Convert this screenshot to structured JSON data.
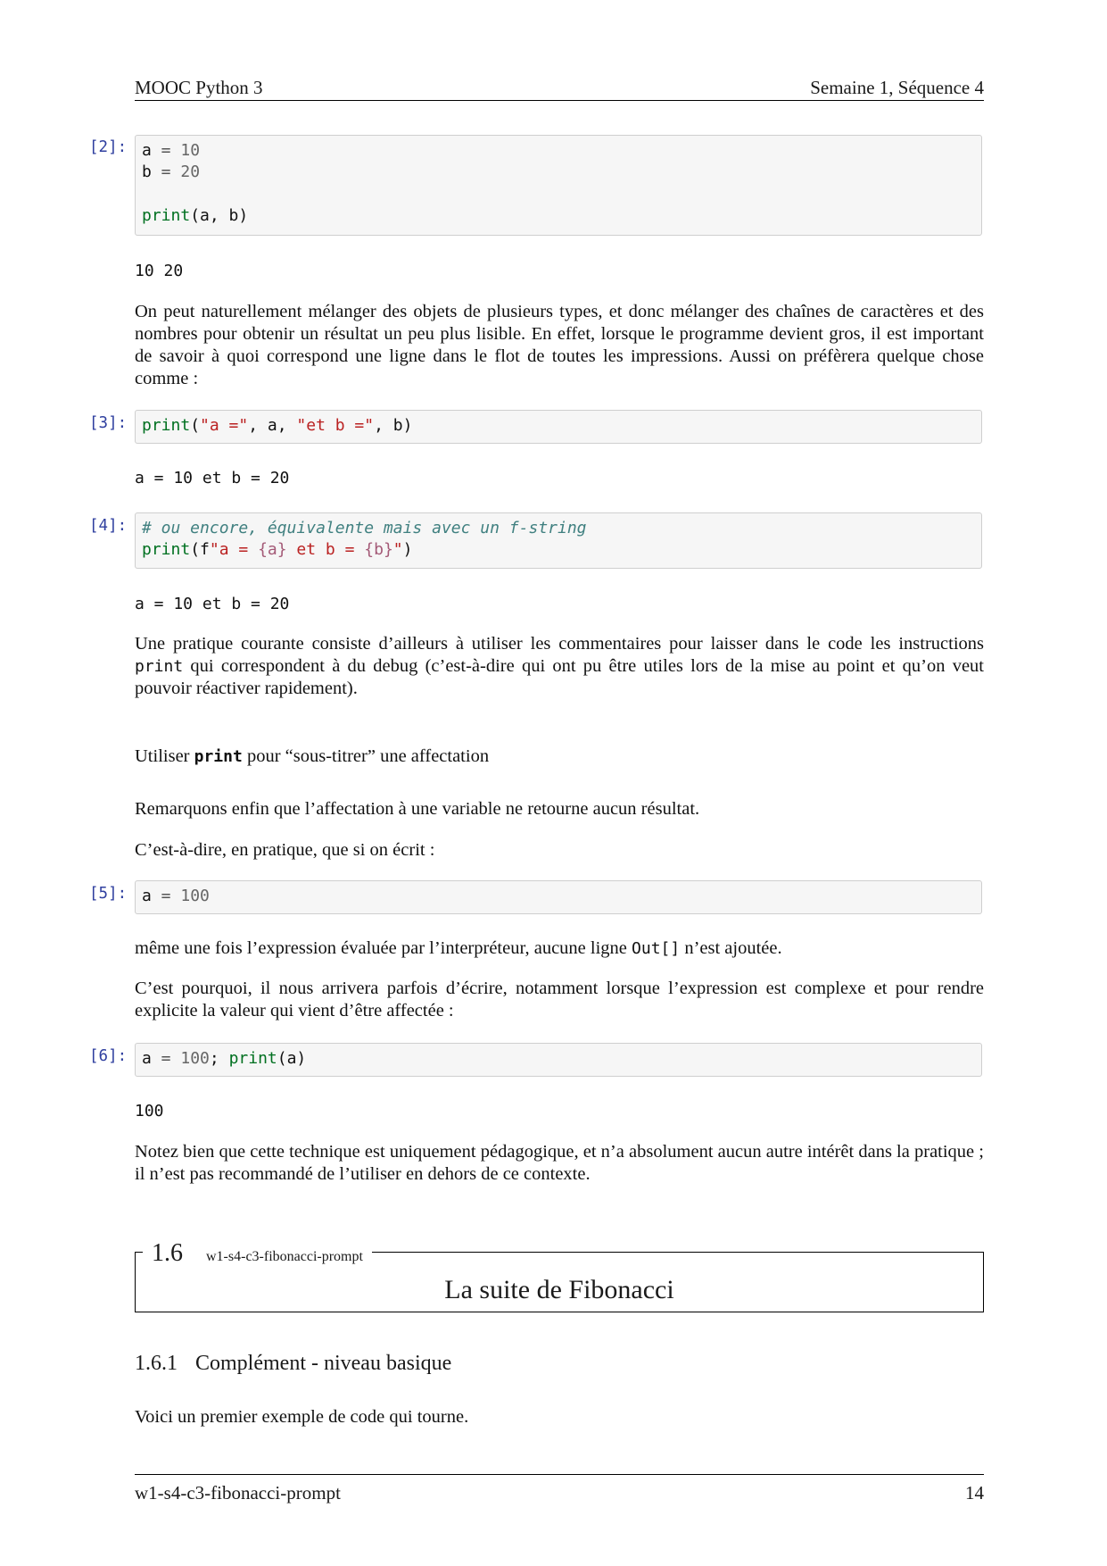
{
  "header": {
    "left": "MOOC Python 3",
    "right": "Semaine 1, Séquence 4"
  },
  "cells": [
    {
      "prompt": "[2]:",
      "lines": [
        [
          [
            "",
            "a"
          ],
          [
            "op",
            " = "
          ],
          [
            "num",
            "10"
          ]
        ],
        [
          [
            "",
            "b"
          ],
          [
            "op",
            " = "
          ],
          [
            "num",
            "20"
          ]
        ],
        [],
        [
          [
            "fn",
            "print"
          ],
          [
            "",
            "(a, b)"
          ]
        ]
      ],
      "output": "10 20"
    },
    {
      "prompt": "[3]:",
      "lines": [
        [
          [
            "fn",
            "print"
          ],
          [
            "",
            "("
          ],
          [
            "str",
            "\"a =\""
          ],
          [
            "",
            ", a, "
          ],
          [
            "str",
            "\"et b =\""
          ],
          [
            "",
            ", b)"
          ]
        ]
      ],
      "output": "a = 10 et b = 20"
    },
    {
      "prompt": "[4]:",
      "lines": [
        [
          [
            "com",
            "# ou encore, équivalente mais avec un f-string"
          ]
        ],
        [
          [
            "fn",
            "print"
          ],
          [
            "",
            "(f"
          ],
          [
            "str",
            "\"a = "
          ],
          [
            "interp",
            "{a}"
          ],
          [
            "str",
            " et b = "
          ],
          [
            "interp",
            "{b}"
          ],
          [
            "str",
            "\""
          ],
          [
            "",
            ")"
          ]
        ]
      ],
      "output": "a = 10 et b = 20"
    },
    {
      "prompt": "[5]:",
      "lines": [
        [
          [
            "",
            "a"
          ],
          [
            "op",
            " = "
          ],
          [
            "num",
            "100"
          ]
        ]
      ],
      "output": ""
    },
    {
      "prompt": "[6]:",
      "lines": [
        [
          [
            "",
            "a"
          ],
          [
            "op",
            " = "
          ],
          [
            "num",
            "100"
          ],
          [
            "",
            "; "
          ],
          [
            "fn",
            "print"
          ],
          [
            "",
            "(a)"
          ]
        ]
      ],
      "output": "100"
    }
  ],
  "paragraphs": {
    "p1": "On peut naturellement mélanger des objets de plusieurs types, et donc mélanger des chaînes de caractères et des nombres pour obtenir un résultat un peu plus lisible. En effet, lorsque le programme devient gros, il est important de savoir à quoi correspond une ligne dans le flot de toutes les impressions. Aussi on préfèrera quelque chose comme :",
    "p2_a": "Une pratique courante consiste d’ailleurs à utiliser les commentaires pour laisser dans le code les instruc­tions ",
    "p2_code": "print",
    "p2_b": " qui correspondent à du debug (c’est-à-dire qui ont pu être utiles lors de la mise au point et qu’on veut pouvoir réactiver rapidement).",
    "h_a": "Utiliser ",
    "h_code": "print",
    "h_b": " pour “sous-titrer” une affectation",
    "p3": "Remarquons enfin que l’affectation à une variable ne retourne aucun résultat.",
    "p4": "C’est-à-dire, en pratique, que si on écrit :",
    "p5_a": "même une fois l’expression évaluée par l’interpréteur, aucune ligne ",
    "p5_code": "Out[]",
    "p5_b": " n’est ajoutée.",
    "p6": "C’est pourquoi, il nous arrivera parfois d’écrire, notamment lorsque l’expression est complexe et pour rendre explicite la valeur qui vient d’être affectée :",
    "p7": "Notez bien que cette technique est uniquement pédagogique, et n’a absolument aucun autre intérêt dans la pratique ; il n’est pas recommandé de l’utiliser en dehors de ce contexte.",
    "p8": "Voici un premier exemple de code qui tourne."
  },
  "section": {
    "number": "1.6",
    "label": "w1-s4-c3-fibonacci-prompt",
    "title": "La suite de Fibonacci"
  },
  "subsection": {
    "number": "1.6.1",
    "title": "Complément - niveau basique"
  },
  "footer": {
    "left": "w1-s4-c3-fibonacci-prompt",
    "right": "14"
  }
}
